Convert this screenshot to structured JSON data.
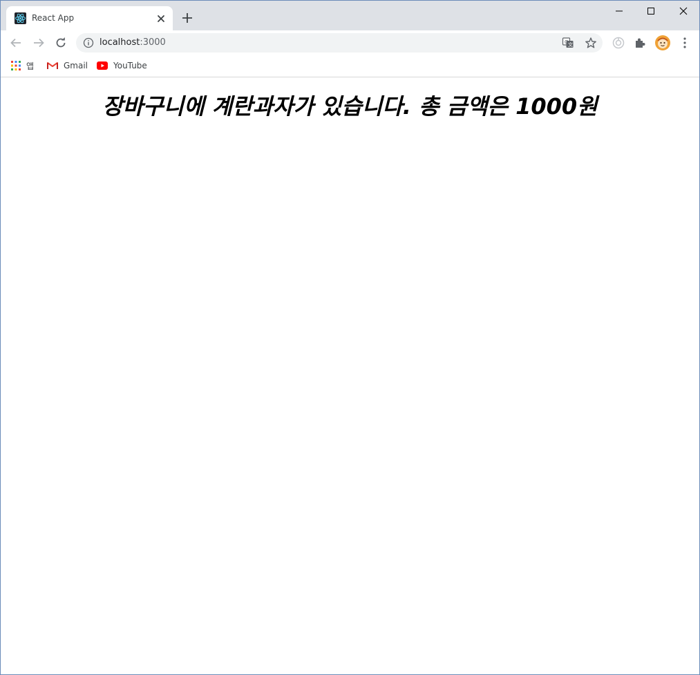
{
  "tab": {
    "title": "React App",
    "favicon": "react-logo-icon"
  },
  "window_controls": [
    "minimize",
    "maximize",
    "close"
  ],
  "address_bar": {
    "host": "localhost",
    "port": ":3000",
    "icon": "info-icon"
  },
  "bookmarks": [
    {
      "label": "앱",
      "icon": "apps-grid-icon"
    },
    {
      "label": "Gmail",
      "icon": "gmail-icon"
    },
    {
      "label": "YouTube",
      "icon": "youtube-icon"
    }
  ],
  "page": {
    "heading": "장바구니에 계란과자가 있습니다. 총 금액은 1000원"
  },
  "colors": {
    "tabstrip": "#dee1e6",
    "omnibox": "#f1f3f4",
    "react_blue": "#61dafb",
    "youtube_red": "#ff0000"
  }
}
